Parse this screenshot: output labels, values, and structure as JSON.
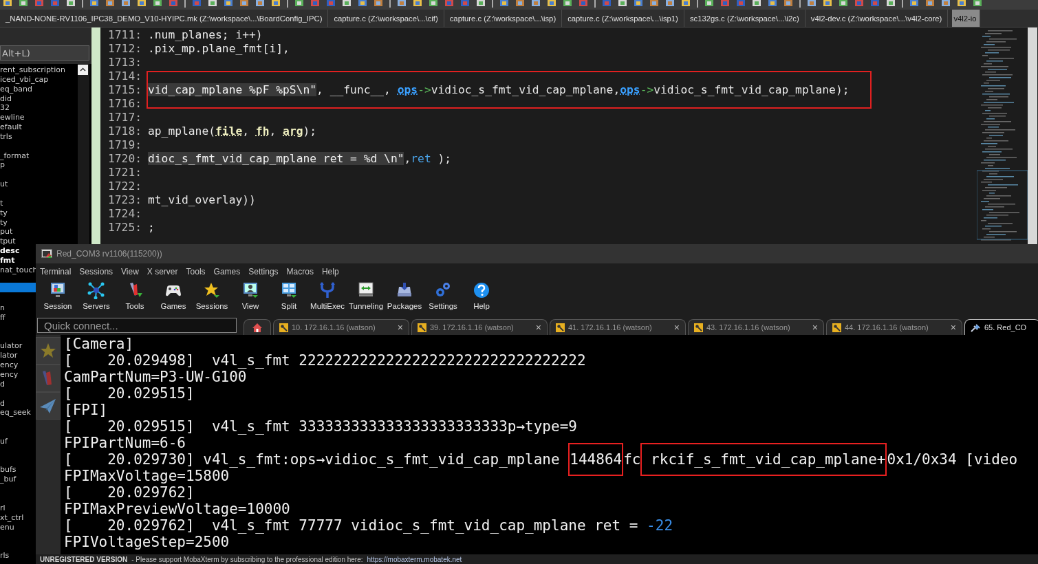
{
  "file_tabs": [
    {
      "label": "_NAND-NONE-RV1106_IPC38_DEMO_V10-HYIPC.mk (Z:\\workspace\\...\\BoardConfig_IPC)",
      "selected": false
    },
    {
      "label": "capture.c (Z:\\workspace\\...\\cif)",
      "selected": false
    },
    {
      "label": "capture.c (Z:\\workspace\\...\\isp)",
      "selected": false
    },
    {
      "label": "capture.c (Z:\\workspace\\...\\isp1)",
      "selected": false
    },
    {
      "label": "sc132gs.c (Z:\\workspace\\...\\i2c)",
      "selected": false
    },
    {
      "label": "v4l2-dev.c (Z:\\workspace\\...\\v4l2-core)",
      "selected": false
    },
    {
      "label": "v4l2-io",
      "selected": true
    }
  ],
  "outline": {
    "search": {
      "placeholder": "Alt+L)"
    },
    "items": [
      {
        "text": "rent_subscription",
        "selected": false,
        "bold": false
      },
      {
        "text": "iced_vbi_cap",
        "selected": false,
        "bold": false
      },
      {
        "text": "eq_band",
        "selected": false,
        "bold": false
      },
      {
        "text": "did",
        "selected": false,
        "bold": false
      },
      {
        "text": "32",
        "selected": false,
        "bold": false
      },
      {
        "text": "ewline",
        "selected": false,
        "bold": false
      },
      {
        "text": "efault",
        "selected": false,
        "bold": false
      },
      {
        "text": "trls",
        "selected": false,
        "bold": false
      },
      {
        "selected": false
      },
      {
        "text": "_format",
        "selected": false,
        "bold": false
      },
      {
        "text": "p",
        "selected": false,
        "bold": false
      },
      {
        "selected": false
      },
      {
        "text": "ut",
        "selected": false,
        "bold": false
      },
      {
        "selected": false
      },
      {
        "text": "t",
        "selected": false,
        "bold": false
      },
      {
        "text": "ty",
        "selected": false,
        "bold": false
      },
      {
        "text": "ty",
        "selected": false,
        "bold": false
      },
      {
        "text": "put",
        "selected": false,
        "bold": false
      },
      {
        "text": "tput",
        "selected": false,
        "bold": false
      },
      {
        "text": "desc",
        "selected": false,
        "bold": true
      },
      {
        "text": "fmt",
        "selected": false,
        "bold": true
      },
      {
        "text": "nat_touch",
        "selected": false,
        "bold": false
      },
      {
        "selected": false
      },
      {
        "selected": true
      },
      {
        "selected": false
      },
      {
        "text": "n",
        "selected": false,
        "bold": false
      },
      {
        "text": "ff",
        "selected": false,
        "bold": false
      },
      {
        "selected": false
      },
      {
        "selected": false
      },
      {
        "text": "ulator",
        "selected": false,
        "bold": false
      },
      {
        "text": "lator",
        "selected": false,
        "bold": false
      },
      {
        "text": "ency",
        "selected": false,
        "bold": false
      },
      {
        "text": "ency",
        "selected": false,
        "bold": false
      },
      {
        "text": "d",
        "selected": false,
        "bold": false
      },
      {
        "selected": false
      },
      {
        "text": "d",
        "selected": false,
        "bold": false
      },
      {
        "text": "eq_seek",
        "selected": false,
        "bold": false
      },
      {
        "selected": false
      },
      {
        "selected": false
      },
      {
        "text": "uf",
        "selected": false,
        "bold": false
      },
      {
        "selected": false
      },
      {
        "selected": false
      },
      {
        "text": "bufs",
        "selected": false,
        "bold": false
      },
      {
        "text": "_buf",
        "selected": false,
        "bold": false
      },
      {
        "selected": false
      },
      {
        "selected": false
      },
      {
        "text": "rl",
        "selected": false,
        "bold": false
      },
      {
        "text": "xt_ctrl",
        "selected": false,
        "bold": false
      },
      {
        "text": "enu",
        "selected": false,
        "bold": false
      },
      {
        "selected": false
      },
      {
        "selected": false
      },
      {
        "text": "rls",
        "selected": false,
        "bold": false
      }
    ]
  },
  "editor": {
    "lines": [
      {
        "number": "1711:",
        "segments": [
          {
            "kind": "plain",
            "text": ".num_planes; i++)"
          }
        ]
      },
      {
        "number": "1712:",
        "segments": [
          {
            "kind": "plain",
            "text": ".pix_mp.plane_fmt[i],"
          }
        ]
      },
      {
        "number": "1713:"
      },
      {
        "number": "1714:"
      },
      {
        "number": "1715:",
        "boxed": true,
        "segments": [
          {
            "kind": "string",
            "text": "vid_cap_mplane %pF %pS\\n\""
          },
          {
            "kind": "plain",
            "text": ", __func__, "
          },
          {
            "kind": "member",
            "text": "ops"
          },
          {
            "kind": "arrow",
            "text": "->"
          },
          {
            "kind": "plain",
            "text": "vidioc_s_fmt_vid_cap_mplane,"
          },
          {
            "kind": "member",
            "text": "ops"
          },
          {
            "kind": "arrow",
            "text": "->"
          },
          {
            "kind": "plain",
            "text": "vidioc_s_fmt_vid_cap_mplane);"
          }
        ]
      },
      {
        "number": "1716:"
      },
      {
        "number": "1717:"
      },
      {
        "number": "1718:",
        "segments": [
          {
            "kind": "plain",
            "text": "ap_mplane("
          },
          {
            "kind": "param",
            "text": "file"
          },
          {
            "kind": "plain",
            "text": ", "
          },
          {
            "kind": "param",
            "text": "fh"
          },
          {
            "kind": "plain",
            "text": ", "
          },
          {
            "kind": "param",
            "text": "arg"
          },
          {
            "kind": "plain",
            "text": ");"
          }
        ]
      },
      {
        "number": "1719:"
      },
      {
        "number": "1720:",
        "segments": [
          {
            "kind": "string",
            "text": "dioc_s_fmt_vid_cap_mplane ret = %d \\n\""
          },
          {
            "kind": "plain",
            "text": ","
          },
          {
            "kind": "variable",
            "text": "ret"
          },
          {
            "kind": "plain",
            "text": " );"
          }
        ]
      },
      {
        "number": "1721:"
      },
      {
        "number": "1722:"
      },
      {
        "number": "1723:",
        "segments": [
          {
            "kind": "plain",
            "text": "mt_vid_overlay))"
          }
        ]
      },
      {
        "number": "1724:"
      },
      {
        "number": "1725:",
        "segments": [
          {
            "kind": "plain",
            "text": ";"
          }
        ]
      }
    ]
  },
  "terminal_window": {
    "title": "Red_COM3 rv1106(115200))",
    "menu": [
      "Terminal",
      "Sessions",
      "View",
      "X server",
      "Tools",
      "Games",
      "Settings",
      "Macros",
      "Help"
    ],
    "toolbar": [
      "Session",
      "Servers",
      "Tools",
      "Games",
      "Sessions",
      "View",
      "Split",
      "MultiExec",
      "Tunneling",
      "Packages",
      "Settings",
      "Help"
    ],
    "quick_connect": {
      "placeholder": "Quick connect..."
    },
    "tabs": [
      {
        "kind": "home",
        "selected": false
      },
      {
        "kind": "ssh",
        "label": "10. 172.16.1.16 (watson)",
        "close": "×",
        "selected": false
      },
      {
        "kind": "ssh",
        "label": "39. 172.16.1.16 (watson)",
        "close": "×",
        "selected": false
      },
      {
        "kind": "ssh",
        "label": "41. 172.16.1.16 (watson)",
        "close": "×",
        "selected": false
      },
      {
        "kind": "ssh",
        "label": "43. 172.16.1.16 (watson)",
        "close": "×",
        "selected": false
      },
      {
        "kind": "ssh",
        "label": "44. 172.16.1.16 (watson)",
        "close": "×",
        "selected": false
      },
      {
        "kind": "serial",
        "label": "65. Red_CO",
        "selected": true
      }
    ],
    "lines": [
      {
        "segments": [
          {
            "kind": "plain",
            "text": "[Camera]"
          }
        ]
      },
      {
        "segments": [
          {
            "kind": "plain",
            "text": "[    20.029498]  v4l_s_fmt 222222222222222222222222222222222"
          }
        ]
      },
      {
        "segments": [
          {
            "kind": "plain",
            "text": "CamPartNum=P3-UW-G100"
          }
        ]
      },
      {
        "segments": [
          {
            "kind": "plain",
            "text": "[    20.029515]"
          }
        ]
      },
      {
        "segments": [
          {
            "kind": "plain",
            "text": "[FPI]"
          }
        ]
      },
      {
        "segments": [
          {
            "kind": "plain",
            "text": "[    20.029515]  v4l_s_fmt 333333333333333333333333p→type=9"
          }
        ]
      },
      {
        "segments": [
          {
            "kind": "plain",
            "text": "FPIPartNum=6-6"
          }
        ]
      },
      {
        "segments": [
          {
            "kind": "plain",
            "text": "[    20.029730] v4l_s_fmt:ops→vidioc_s_fmt_vid_cap_mplane "
          },
          {
            "kind": "plain",
            "text": "144864",
            "boxed": true
          },
          {
            "kind": "plain",
            "text": "fc"
          },
          {
            "kind": "plain",
            "text": " rkcif_s_fmt_vid_cap_mplane+",
            "boxed": true
          },
          {
            "kind": "plain",
            "text": "0x1/0x34 [video"
          }
        ]
      },
      {
        "segments": [
          {
            "kind": "plain",
            "text": "FPIMaxVoltage=15800"
          }
        ]
      },
      {
        "segments": [
          {
            "kind": "plain",
            "text": "[    20.029762]"
          }
        ]
      },
      {
        "segments": [
          {
            "kind": "plain",
            "text": "FPIMaxPreviewVoltage=10000"
          }
        ]
      },
      {
        "segments": [
          {
            "kind": "plain",
            "text": "[    20.029762]  v4l_s_fmt 77777 vidioc_s_fmt_vid_cap_mplane ret = "
          },
          {
            "kind": "number",
            "text": "-22"
          }
        ]
      },
      {
        "segments": [
          {
            "kind": "plain",
            "text": "FPIVoltageStep=2500"
          }
        ]
      }
    ],
    "status_bar": {
      "notice": "UNREGISTERED VERSION",
      "message": "-  Please support MobaXterm by subscribing to the professional edition here:",
      "link": "https://mobaxterm.mobatek.net"
    }
  }
}
